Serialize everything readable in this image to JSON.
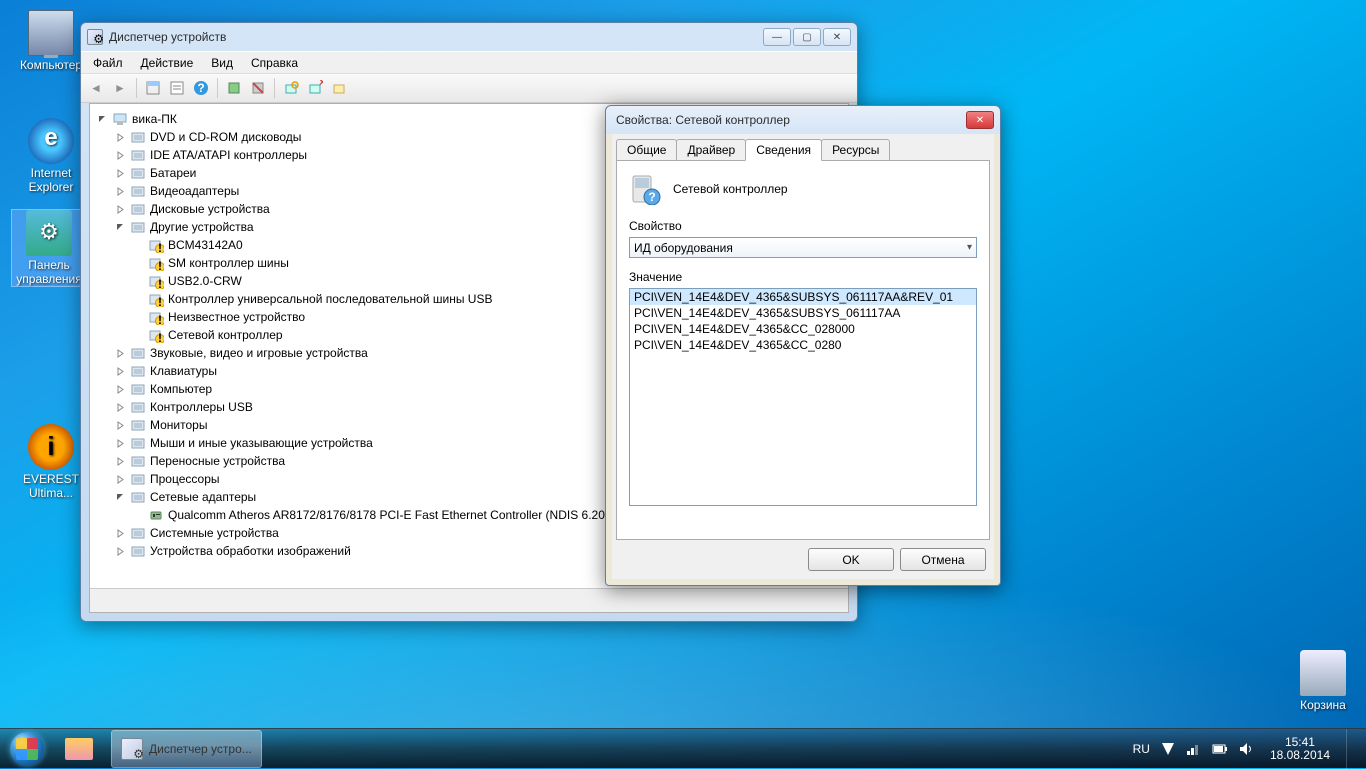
{
  "desktop_icons": [
    {
      "name": "computer-icon",
      "label": "Компьютер",
      "cls": "i-monitor"
    },
    {
      "name": "ie-icon",
      "label": "Internet Explorer",
      "cls": "i-ie"
    },
    {
      "name": "control-panel-icon",
      "label": "Панель управления",
      "cls": "i-controlpanel",
      "selected": true
    },
    {
      "name": "everest-icon",
      "label": "EVEREST Ultima...",
      "cls": "i-everest"
    },
    {
      "name": "recycle-bin-icon",
      "label": "Корзина",
      "cls": "i-bin"
    }
  ],
  "device_manager": {
    "title": "Диспетчер устройств",
    "menus": [
      "Файл",
      "Действие",
      "Вид",
      "Справка"
    ],
    "root": "вика-ПК",
    "categories": [
      {
        "label": "DVD и CD-ROM дисководы"
      },
      {
        "label": "IDE ATA/ATAPI контроллеры"
      },
      {
        "label": "Батареи"
      },
      {
        "label": "Видеоадаптеры"
      },
      {
        "label": "Дисковые устройства"
      },
      {
        "label": "Другие устройства",
        "expanded": true,
        "children": [
          {
            "label": "BCM43142A0",
            "warn": true
          },
          {
            "label": "SM контроллер шины",
            "warn": true
          },
          {
            "label": "USB2.0-CRW",
            "warn": true
          },
          {
            "label": "Контроллер универсальной последовательной шины USB",
            "warn": true
          },
          {
            "label": "Неизвестное устройство",
            "warn": true
          },
          {
            "label": "Сетевой контроллер",
            "warn": true
          }
        ]
      },
      {
        "label": "Звуковые, видео и игровые устройства"
      },
      {
        "label": "Клавиатуры"
      },
      {
        "label": "Компьютер"
      },
      {
        "label": "Контроллеры USB"
      },
      {
        "label": "Мониторы"
      },
      {
        "label": "Мыши и иные указывающие устройства"
      },
      {
        "label": "Переносные устройства"
      },
      {
        "label": "Процессоры"
      },
      {
        "label": "Сетевые адаптеры",
        "expanded": true,
        "children": [
          {
            "label": "Qualcomm Atheros AR8172/8176/8178 PCI-E Fast Ethernet Controller (NDIS 6.20)"
          }
        ]
      },
      {
        "label": "Системные устройства"
      },
      {
        "label": "Устройства обработки изображений"
      }
    ]
  },
  "properties": {
    "title": "Свойства: Сетевой контроллер",
    "tabs": [
      "Общие",
      "Драйвер",
      "Сведения",
      "Ресурсы"
    ],
    "active_tab": 2,
    "device_name": "Сетевой контроллер",
    "property_label": "Свойство",
    "property_value": "ИД оборудования",
    "value_label": "Значение",
    "values": [
      "PCI\\VEN_14E4&DEV_4365&SUBSYS_061117AA&REV_01",
      "PCI\\VEN_14E4&DEV_4365&SUBSYS_061117AA",
      "PCI\\VEN_14E4&DEV_4365&CC_028000",
      "PCI\\VEN_14E4&DEV_4365&CC_0280"
    ],
    "ok": "OK",
    "cancel": "Отмена"
  },
  "taskbar": {
    "active_window": "Диспетчер устро...",
    "lang": "RU",
    "time": "15:41",
    "date": "18.08.2014"
  }
}
